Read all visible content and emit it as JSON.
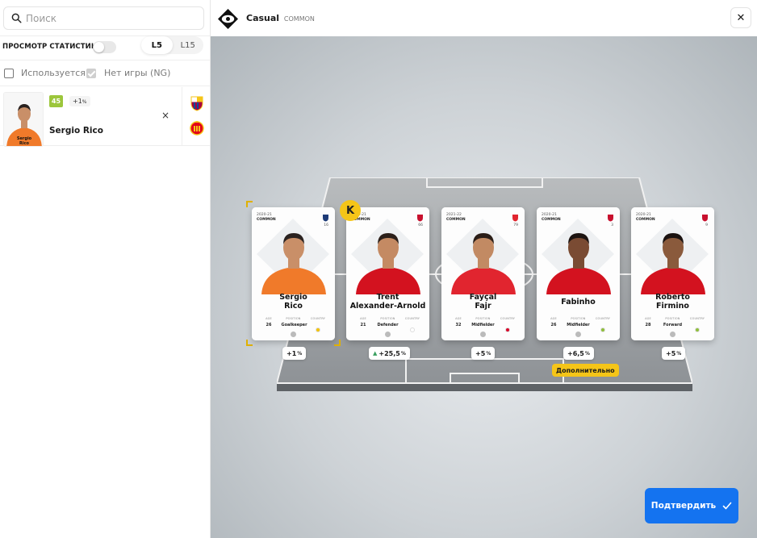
{
  "search": {
    "placeholder": "Поиск"
  },
  "stats": {
    "label": "ПРОСМОТР СТАТИСТИКИ",
    "toggle_on": false
  },
  "period_tabs": [
    {
      "label": "L5",
      "active": true
    },
    {
      "label": "L15",
      "active": false
    }
  ],
  "filters": [
    {
      "label": "Используется",
      "checked": false
    },
    {
      "label": "Нет игры (NG)",
      "checked": true
    }
  ],
  "selected_player": {
    "name": "Sergio Rico",
    "mini_card_name": "Sergio Rico",
    "score": "45",
    "bonus": "+1",
    "bonus_unit": "%",
    "remove": "×",
    "clubs": [
      "barcelona-crest-icon",
      "mallorca-crest-icon"
    ]
  },
  "header": {
    "title": "Casual",
    "rarity": "COMMON",
    "close": "✕"
  },
  "captain_badge": "K",
  "cards": [
    {
      "season": "2020-21",
      "rarity": "COMMON",
      "number": "16",
      "name_line1": "Sergio",
      "name_line2": "Rico",
      "age_label": "AGE",
      "age": "26",
      "position_label": "POSITION",
      "position": "Goalkeeper",
      "country_label": "COUNTRY",
      "bonus": "+1",
      "bonus_unit": "%",
      "club_icon": "psg-crest-icon",
      "shirt": "#f07a2a",
      "skin": "#c98f68",
      "hair": "#2a2220"
    },
    {
      "season": "2020-21",
      "rarity": "COMMON",
      "number": "66",
      "name_line1": "Trent",
      "name_line2": "Alexander-Arnold",
      "age_label": "AGE",
      "age": "21",
      "position_label": "POSITION",
      "position": "Defender",
      "country_label": "COUNTRY",
      "bonus": "+25,5",
      "bonus_unit": "%",
      "club_icon": "liverpool-crest-icon",
      "shirt": "#d3121f",
      "skin": "#c48a63",
      "hair": "#2b1f19"
    },
    {
      "season": "2021-22",
      "rarity": "COMMON",
      "number": "79",
      "name_line1": "Fayçal",
      "name_line2": "Fajr",
      "age_label": "AGE",
      "age": "32",
      "position_label": "POSITION",
      "position": "Midfielder",
      "country_label": "COUNTRY",
      "bonus": "+5",
      "bonus_unit": "%",
      "club_icon": "sivasspor-crest-icon",
      "shirt": "#e1252f",
      "skin": "#c28a63",
      "hair": "#2a1d17"
    },
    {
      "season": "2020-21",
      "rarity": "COMMON",
      "number": "3",
      "name_line1": "Fabinho",
      "name_line2": "",
      "age_label": "AGE",
      "age": "26",
      "position_label": "POSITION",
      "position": "Midfielder",
      "country_label": "COUNTRY",
      "bonus": "+6,5",
      "bonus_unit": "%",
      "club_icon": "liverpool-crest-icon",
      "shirt": "#d3121f",
      "skin": "#7a4b33",
      "hair": "#1d1411"
    },
    {
      "season": "2020-21",
      "rarity": "COMMON",
      "number": "9",
      "name_line1": "Roberto",
      "name_line2": "Firmino",
      "age_label": "AGE",
      "age": "28",
      "position_label": "POSITION",
      "position": "Forward",
      "country_label": "COUNTRY",
      "bonus": "+5",
      "bonus_unit": "%",
      "club_icon": "liverpool-crest-icon",
      "shirt": "#d3121f",
      "skin": "#8a5a3c",
      "hair": "#1a1210"
    }
  ],
  "extra_label": "Дополнительно",
  "confirm": {
    "label": "Подтвердить"
  },
  "colors": {
    "accent": "#1473f0",
    "captain": "#f5c518",
    "score_green": "#9cc63b"
  }
}
